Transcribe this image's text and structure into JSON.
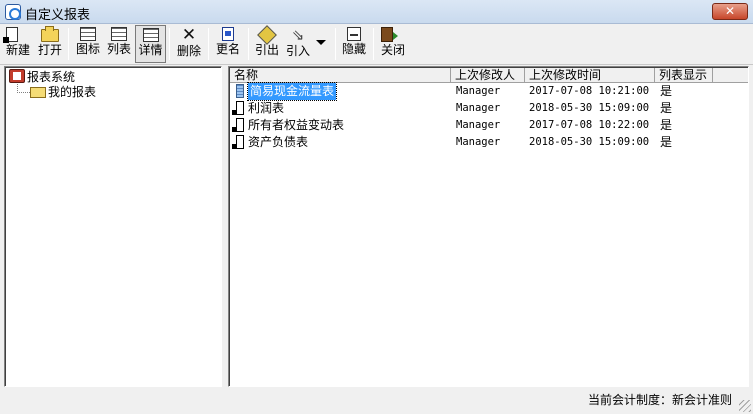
{
  "window": {
    "title": "自定义报表",
    "close_glyph": "✕"
  },
  "toolbar": {
    "new_label": "新建",
    "open_label": "打开",
    "icon_view_label": "图标",
    "list_view_label": "列表",
    "detail_view_label": "详情",
    "delete_label": "删除",
    "rename_label": "更名",
    "export_label": "引出",
    "import_label": "引入",
    "hide_label": "隐藏",
    "close_label": "关闭"
  },
  "tree": {
    "root_label": "报表系统",
    "child_label": "我的报表"
  },
  "list": {
    "columns": [
      "名称",
      "上次修改人",
      "上次修改时间",
      "列表显示"
    ],
    "rows": [
      {
        "name": "简易现金流量表",
        "modified_by": "Manager",
        "modified_time": "2017-07-08 10:21:00",
        "visible": "是",
        "selected": true
      },
      {
        "name": "利润表",
        "modified_by": "Manager",
        "modified_time": "2018-05-30 15:09:00",
        "visible": "是",
        "selected": false
      },
      {
        "name": "所有者权益变动表",
        "modified_by": "Manager",
        "modified_time": "2017-07-08 10:22:00",
        "visible": "是",
        "selected": false
      },
      {
        "name": "资产负债表",
        "modified_by": "Manager",
        "modified_time": "2018-05-30 15:09:00",
        "visible": "是",
        "selected": false
      }
    ]
  },
  "status": {
    "text": "当前会计制度：新会计准则"
  },
  "colors": {
    "selection": "#3399ff",
    "close_button": "#c7462a",
    "titlebar": "#dbe7f5"
  }
}
